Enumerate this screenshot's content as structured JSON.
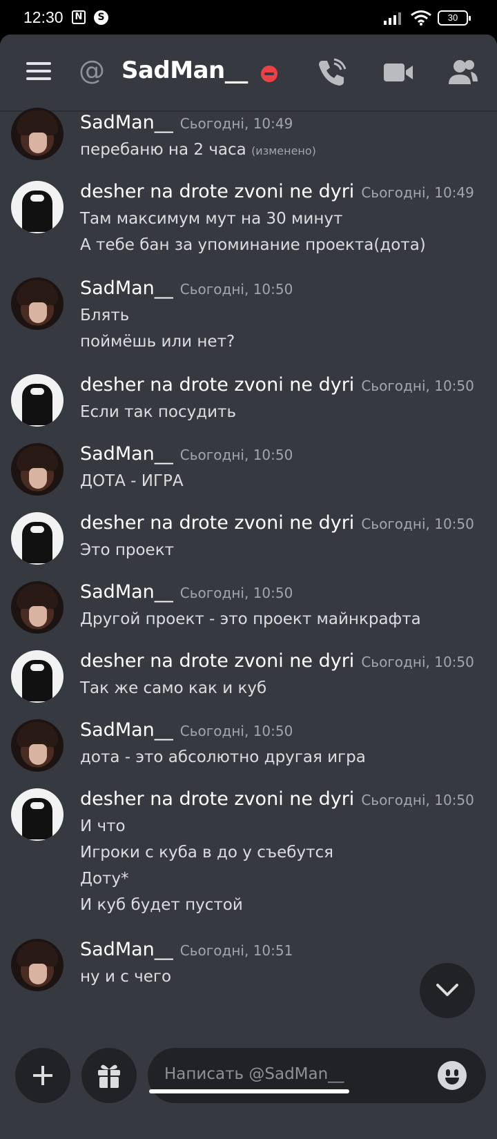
{
  "status_bar": {
    "time": "12:30",
    "icon_n": "N",
    "icon_s": "S",
    "battery": "30"
  },
  "header": {
    "at_symbol": "@",
    "title": "SadMan__"
  },
  "messages": [
    {
      "author": "SadMan__",
      "time": "Сьогодні, 10:49",
      "lines": [
        "перебаню на 2 часа"
      ],
      "edited": "(изменено)"
    },
    {
      "author": "desher na drote zvoni ne dyri",
      "time": "Сьогодні, 10:49",
      "lines": [
        "Там максимум мут на 30 минут",
        "А тебе бан за упоминание проекта(дота)"
      ]
    },
    {
      "author": "SadMan__",
      "time": "Сьогодні, 10:50",
      "lines": [
        "Блять",
        "поймёшь или нет?"
      ]
    },
    {
      "author": "desher na drote zvoni ne dyri",
      "time": "Сьогодні, 10:50",
      "lines": [
        "Если так посудить"
      ]
    },
    {
      "author": "SadMan__",
      "time": "Сьогодні, 10:50",
      "lines": [
        "ДОТА - ИГРА"
      ]
    },
    {
      "author": "desher na drote zvoni ne dyri",
      "time": "Сьогодні, 10:50",
      "lines": [
        "Это проект"
      ]
    },
    {
      "author": "SadMan__",
      "time": "Сьогодні, 10:50",
      "lines": [
        "Другой проект - это проект майнкрафта"
      ]
    },
    {
      "author": "desher na drote zvoni ne dyri",
      "time": "Сьогодні, 10:50",
      "lines": [
        "Так же само как и куб"
      ]
    },
    {
      "author": "SadMan__",
      "time": "Сьогодні, 10:50",
      "lines": [
        "дота - это абсолютно другая игра"
      ]
    },
    {
      "author": "desher na drote zvoni ne dyri",
      "time": "Сьогодні, 10:50",
      "lines": [
        "И что",
        "Игроки с куба в до у съебутся",
        "Доту*",
        "И куб будет пустой"
      ]
    },
    {
      "author": "SadMan__",
      "time": "Сьогодні, 10:51",
      "lines": [
        "ну и с чего"
      ]
    }
  ],
  "composer": {
    "placeholder": "Написать @SadMan__"
  },
  "colors": {
    "background": "#36393f",
    "dark_button": "#202225",
    "dnd_red": "#ed4245",
    "muted_text": "#a3a6aa"
  },
  "icons": [
    "menu-icon",
    "at-icon",
    "do-not-disturb-icon",
    "phone-call-icon",
    "video-call-icon",
    "members-icon",
    "chevron-down-icon",
    "plus-icon",
    "gift-icon",
    "emoji-icon"
  ]
}
